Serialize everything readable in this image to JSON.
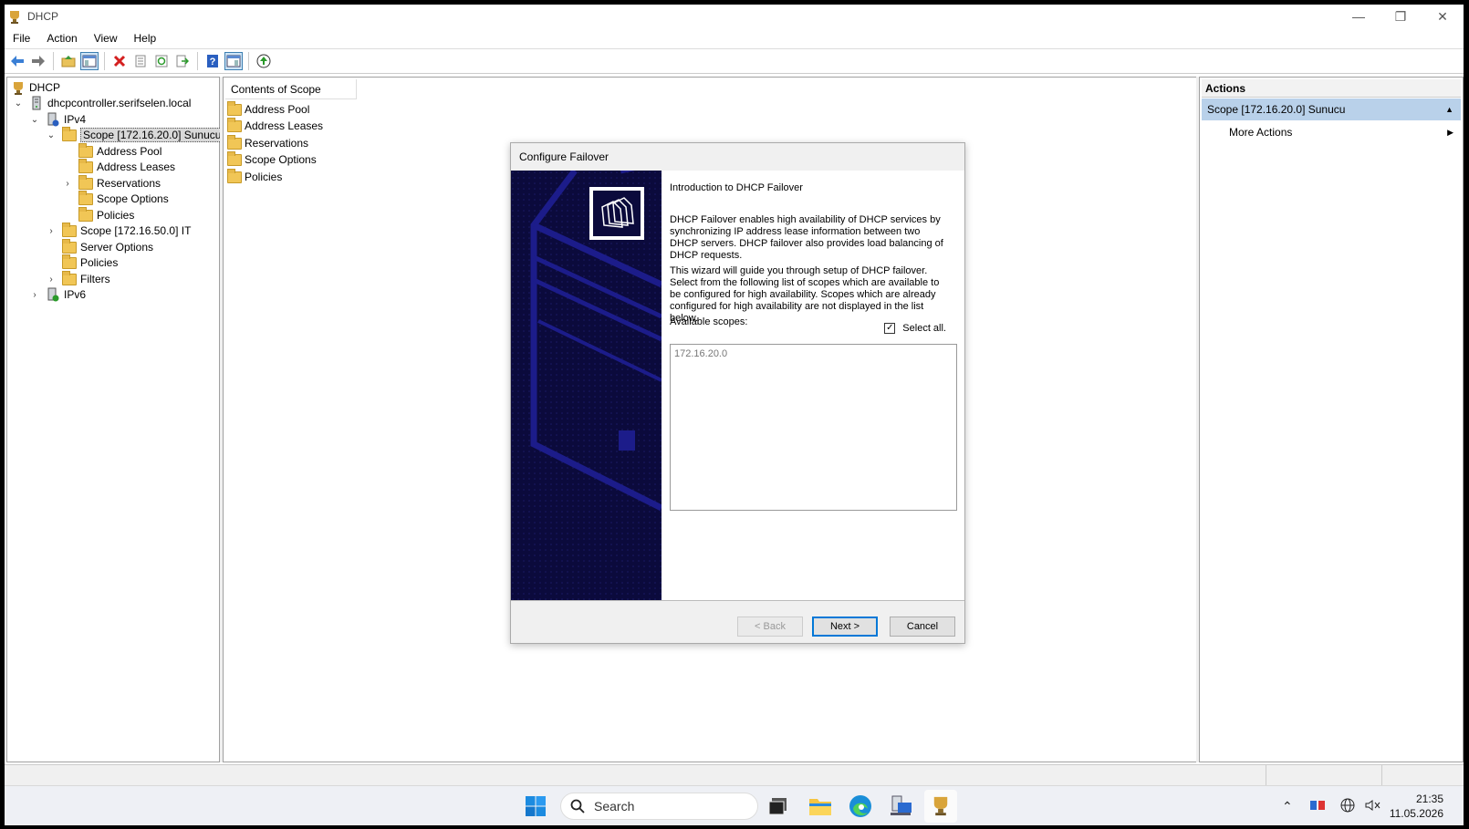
{
  "window": {
    "title": "DHCP"
  },
  "menu": [
    "File",
    "Action",
    "View",
    "Help"
  ],
  "tree": {
    "root": "DHCP",
    "server": "dhcpcontroller.serifselen.local",
    "ipv4": "IPv4",
    "scope1": "Scope [172.16.20.0] Sunucu",
    "scope1_children": [
      "Address Pool",
      "Address Leases",
      "Reservations",
      "Scope Options",
      "Policies"
    ],
    "scope2": "Scope [172.16.50.0] IT",
    "server_options": "Server Options",
    "policies": "Policies",
    "filters": "Filters",
    "ipv6": "IPv6"
  },
  "content": {
    "header": "Contents of Scope",
    "items": [
      "Address Pool",
      "Address Leases",
      "Reservations",
      "Scope Options",
      "Policies"
    ]
  },
  "actions": {
    "header": "Actions",
    "scope": "Scope [172.16.20.0] Sunucu",
    "more": "More Actions"
  },
  "dialog": {
    "title": "Configure Failover",
    "heading": "Introduction to DHCP Failover",
    "para1": "DHCP Failover enables high availability of DHCP services by synchronizing IP address lease information between two DHCP servers. DHCP failover also provides load balancing of DHCP requests.",
    "para2": "This wizard will guide you through setup of DHCP failover. Select from the following list of scopes which are available to be configured for high availability. Scopes which are already configured for high availability are not displayed in the list below.",
    "available_label": "Available scopes:",
    "select_all": "Select all.",
    "select_all_checked": true,
    "scopes": [
      "172.16.20.0"
    ],
    "back": "< Back",
    "next": "Next >",
    "cancel": "Cancel"
  },
  "taskbar": {
    "search_placeholder": "Search",
    "time": "21:35",
    "date": "11.05.2026"
  },
  "colors": {
    "accent": "#0078d7",
    "banner": "#0b0a3c",
    "selection": "#b9d1ea"
  }
}
